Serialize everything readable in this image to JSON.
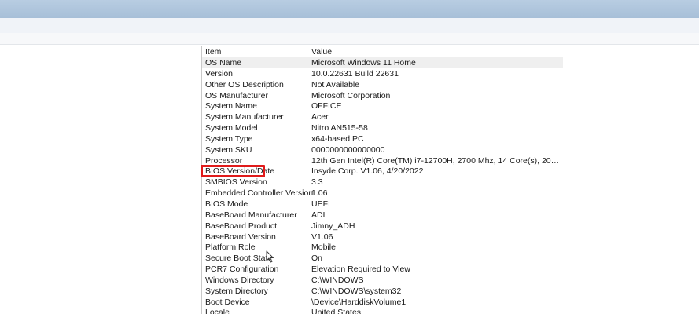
{
  "list": {
    "headers": {
      "item": "Item",
      "value": "Value"
    },
    "rows": [
      {
        "item": "OS Name",
        "value": "Microsoft Windows 11 Home"
      },
      {
        "item": "Version",
        "value": "10.0.22631 Build 22631"
      },
      {
        "item": "Other OS Description",
        "value": "Not Available"
      },
      {
        "item": "OS Manufacturer",
        "value": "Microsoft Corporation"
      },
      {
        "item": "System Name",
        "value": "OFFICE"
      },
      {
        "item": "System Manufacturer",
        "value": "Acer"
      },
      {
        "item": "System Model",
        "value": "Nitro AN515-58"
      },
      {
        "item": "System Type",
        "value": "x64-based PC"
      },
      {
        "item": "System SKU",
        "value": "0000000000000000"
      },
      {
        "item": "Processor",
        "value": "12th Gen Intel(R) Core(TM) i7-12700H, 2700 Mhz, 14 Core(s), 20 Logical Proc..."
      },
      {
        "item": "BIOS Version/Date",
        "value": "Insyde Corp. V1.06, 4/20/2022"
      },
      {
        "item": "SMBIOS Version",
        "value": "3.3"
      },
      {
        "item": "Embedded Controller Version",
        "value": "1.06"
      },
      {
        "item": "BIOS Mode",
        "value": "UEFI"
      },
      {
        "item": "BaseBoard Manufacturer",
        "value": "ADL"
      },
      {
        "item": "BaseBoard Product",
        "value": "Jimny_ADH"
      },
      {
        "item": "BaseBoard Version",
        "value": "V1.06"
      },
      {
        "item": "Platform Role",
        "value": "Mobile"
      },
      {
        "item": "Secure Boot State",
        "value": "On"
      },
      {
        "item": "PCR7 Configuration",
        "value": "Elevation Required to View"
      },
      {
        "item": "Windows Directory",
        "value": "C:\\WINDOWS"
      },
      {
        "item": "System Directory",
        "value": "C:\\WINDOWS\\system32"
      },
      {
        "item": "Boot Device",
        "value": "\\Device\\HarddiskVolume1"
      },
      {
        "item": "Locale",
        "value": "United States"
      }
    ]
  },
  "colors": {
    "highlight_box": "#e01b1b",
    "selected_row": "#efefef",
    "titlebar": "#a7bfd8"
  },
  "icons": {
    "cursor": "mouse-pointer-icon"
  }
}
